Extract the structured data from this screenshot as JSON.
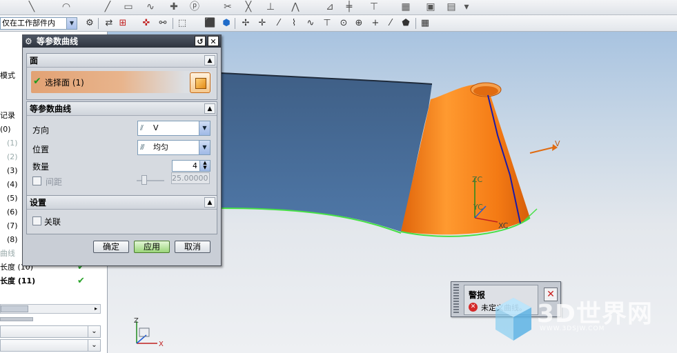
{
  "toolbar": {
    "filter_value": "仅在工作部件内"
  },
  "navigator": {
    "rows": [
      {
        "text": "模式",
        "gray": false
      },
      {
        "text": "记录",
        "gray": false
      },
      {
        "text": "(0)",
        "gray": false
      },
      {
        "text": "(1)",
        "gray": true
      },
      {
        "text": "(2)",
        "gray": true
      },
      {
        "text": "(3)",
        "gray": false
      },
      {
        "text": "(4)",
        "gray": false
      },
      {
        "text": "(5)",
        "gray": false
      },
      {
        "text": "(6)",
        "gray": false
      },
      {
        "text": "(7)",
        "gray": false
      },
      {
        "text": "(8)",
        "gray": false
      },
      {
        "text": "曲线",
        "gray": true
      },
      {
        "text": "长度 (10)",
        "gray": false
      },
      {
        "text": "长度 (11)",
        "gray": false
      }
    ]
  },
  "dialog": {
    "title": "等参数曲线",
    "reset_glyph": "↺",
    "close_glyph": "✕",
    "face_section": {
      "header": "面",
      "select_label": "选择面 (1)"
    },
    "curve_section": {
      "header": "等参数曲线",
      "direction_label": "方向",
      "direction_value": "V",
      "position_label": "位置",
      "position_value": "均匀",
      "count_label": "数量",
      "count_value": "4",
      "spacing_label": "间距",
      "spacing_value": "25.00000"
    },
    "settings_section": {
      "header": "设置",
      "associative_label": "关联"
    },
    "buttons": {
      "ok": "确定",
      "apply": "应用",
      "cancel": "取消"
    }
  },
  "viewport": {
    "axis_labels": {
      "v": "V",
      "zc": "ZC",
      "yc": "YC",
      "xc": "XC",
      "z": "Z",
      "x": "X"
    },
    "model_color": "#f07a12",
    "surface_color": "#3f5f86"
  },
  "warning": {
    "title": "警报",
    "message": "未定义曲线。"
  },
  "watermark": {
    "brand": "3D世界网",
    "url": "WWW.3DSJW.COM"
  }
}
